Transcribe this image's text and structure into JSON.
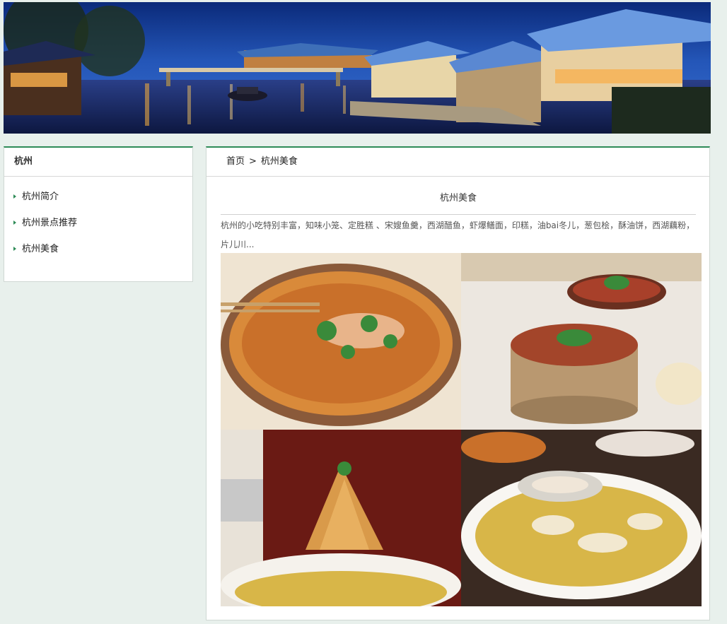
{
  "sidebar": {
    "title": "杭州",
    "items": [
      {
        "label": "杭州简介"
      },
      {
        "label": "杭州景点推荐"
      },
      {
        "label": "杭州美食"
      }
    ]
  },
  "breadcrumb": {
    "home": "首页",
    "separator": ">",
    "current": "杭州美食"
  },
  "article": {
    "title": "杭州美食",
    "body": "杭州的小吃特别丰富，知味小笼、定胜糕 、宋嫂鱼羹，西湖醋鱼，虾爆鳝面，印糕，油bai冬儿，葱包桧，酥油饼，西湖藕粉，片儿川..."
  },
  "colors": {
    "accent": "#2e8b57",
    "background": "#e8f0ec"
  }
}
